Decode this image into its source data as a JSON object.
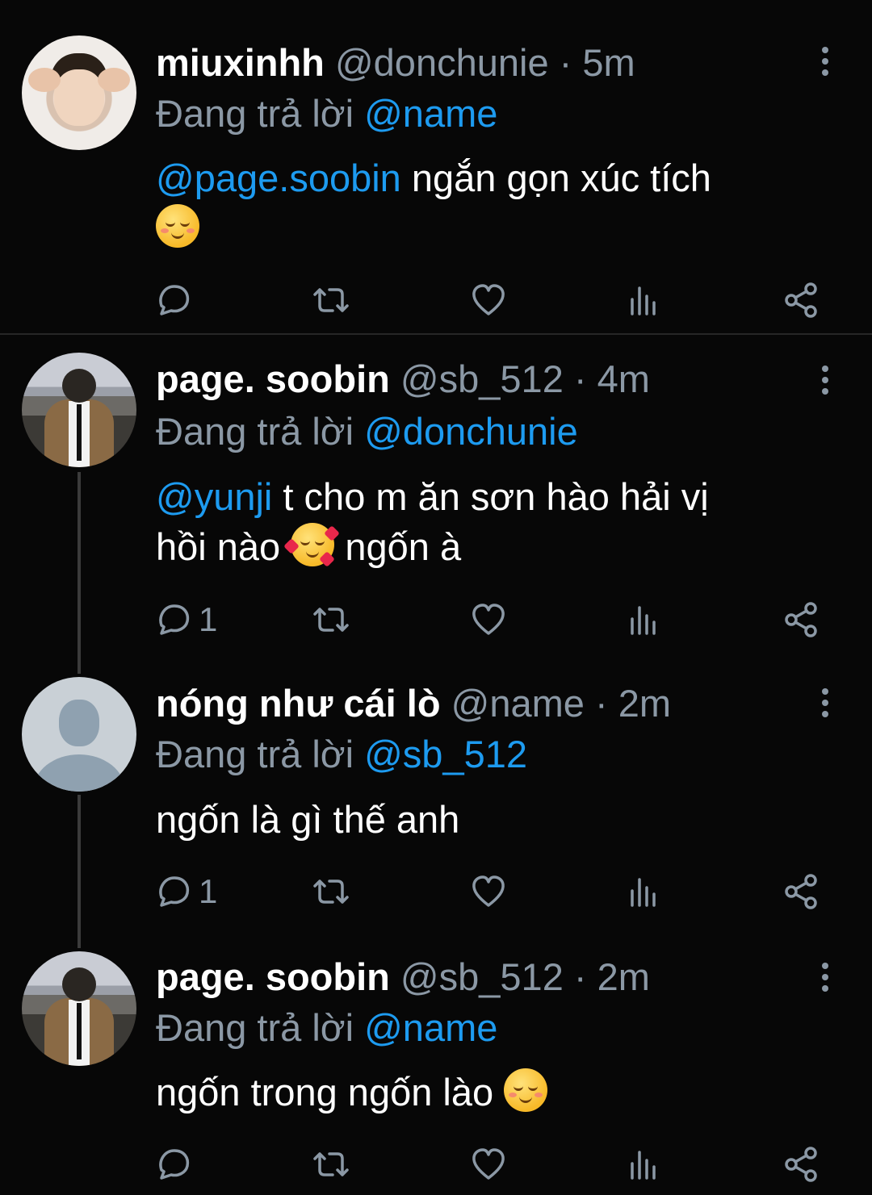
{
  "tweets": [
    {
      "name": "miuxinhh",
      "handle": "@donchunie",
      "time": "5m",
      "reply_prefix": "Đang trả lời",
      "reply_to": "@name",
      "mention": "@page.soobin",
      "text": " ngắn gọn xúc tích",
      "text2": "",
      "reply_count": "",
      "emoji": "relieved-face"
    },
    {
      "name": "page. soobin",
      "handle": "@sb_512",
      "time": "4m",
      "reply_prefix": "Đang trả lời",
      "reply_to": "@donchunie",
      "mention": "@yunji",
      "text": " t cho m ăn sơn hào hải vị",
      "text2": "hồi nào",
      "text3": " ngốn à",
      "reply_count": "1",
      "emoji": "smiling-face-with-hearts"
    },
    {
      "name": "nóng như cái lò",
      "handle": "@name",
      "time": "2m",
      "reply_prefix": "Đang trả lời",
      "reply_to": "@sb_512",
      "text": "ngốn là gì thế anh",
      "reply_count": "1"
    },
    {
      "name": "page. soobin",
      "handle": "@sb_512",
      "time": "2m",
      "reply_prefix": "Đang trả lời",
      "reply_to": "@name",
      "text": "ngốn trong ngốn lào ",
      "reply_count": "",
      "emoji": "smiling-face"
    }
  ],
  "separator": "·",
  "colors": {
    "background": "#070707",
    "secondary_text": "#8b98a5",
    "link": "#1d9bf0"
  }
}
